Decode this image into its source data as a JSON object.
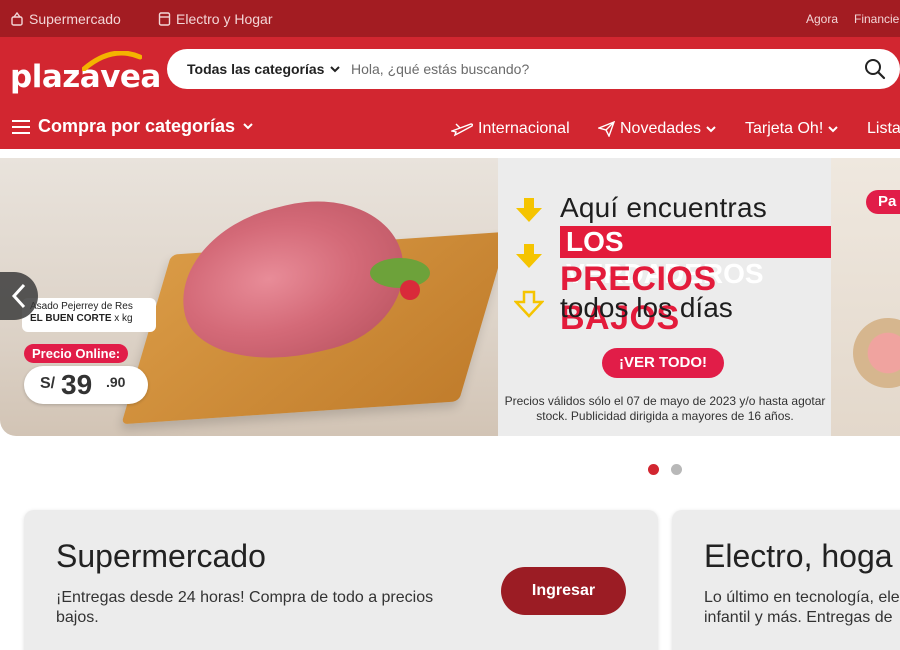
{
  "topbar": {
    "supermercado": "Supermercado",
    "electro": "Electro y Hogar",
    "agora": "Agora",
    "financiera": "Financie"
  },
  "header": {
    "logo": "plazavea",
    "search_category": "Todas las categorías",
    "search_placeholder": "Hola, ¿qué estás buscando?",
    "nav": {
      "categories": "Compra por categorías",
      "internacional": "Internacional",
      "novedades": "Novedades",
      "tarjeta": "Tarjeta Oh!",
      "lista": "Lista"
    }
  },
  "banner": {
    "product_name": "Asado Pejerrey de Res",
    "product_brand": "EL BUEN CORTE",
    "product_unit": "x kg",
    "price_label": "Precio Online:",
    "price_currency": "S/",
    "price_integer": "39",
    "price_decimal": ".90",
    "promo_line1": "Aquí encuentras",
    "promo_line2": "LOS VERDADEROS",
    "promo_line3": "PRECIOS BAJOS",
    "promo_line4": "todos los días",
    "cta": "¡VER TODO!",
    "legal": "Precios válidos sólo el 07 de mayo de 2023 y/o hasta agotar stock. Publicidad dirigida a mayores de 16 años.",
    "right_badge": "Pa",
    "slides": 2,
    "active_slide": 1
  },
  "cards": [
    {
      "title": "Supermercado",
      "desc": "¡Entregas desde 24 horas! Compra de todo a precios bajos.",
      "button": "Ingresar"
    },
    {
      "title": "Electro, hoga",
      "desc": "Lo último en tecnología, ele infantil y más. Entregas de"
    }
  ],
  "colors": {
    "brand_red": "#d22630",
    "topbar_red": "#a31c22",
    "promo_red": "#e31b3b",
    "logo_yellow": "#f4b400"
  }
}
